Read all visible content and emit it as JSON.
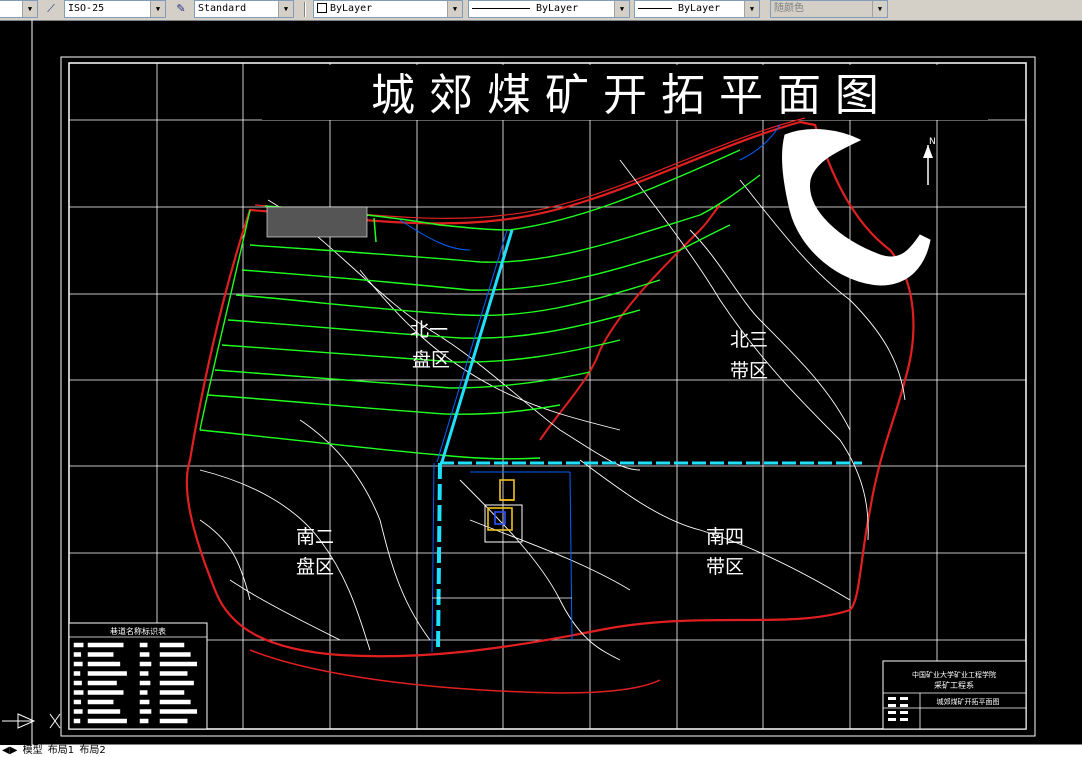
{
  "toolbar": {
    "dimstyle": "ISO-25",
    "textstyle": "Standard",
    "layer_color": "ByLayer",
    "linetype": "ByLayer",
    "lineweight": "ByLayer",
    "plotstyle": "随颜色"
  },
  "drawing": {
    "title": "城 郊 煤 矿 开 拓 平 面 图",
    "north": "N",
    "zones": [
      {
        "line1": "北一",
        "line2": "盘区"
      },
      {
        "line1": "北三",
        "line2": "带区"
      },
      {
        "line1": "南二",
        "line2": "盘区"
      },
      {
        "line1": "南四",
        "line2": "带区"
      }
    ],
    "legend_title": "巷道名称标识表",
    "titleblock_school": "中国矿业大学矿业工程学院",
    "titleblock_dept": "采矿工程系",
    "titleblock_name": "城郊煤矿开拓平面图"
  },
  "tabs": {
    "model": "模型",
    "layout1": "布局1",
    "layout2": "布局2"
  }
}
